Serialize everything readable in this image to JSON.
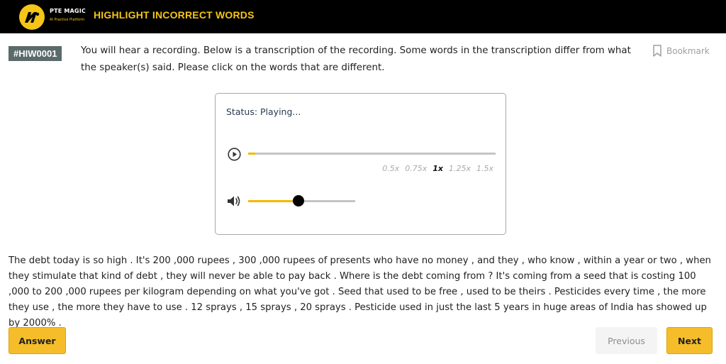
{
  "header": {
    "brand_name": "PTE MAGIC",
    "brand_tagline": "AI Practice Platform",
    "title": "HIGHLIGHT INCORRECT WORDS",
    "accent_color": "#f5c518"
  },
  "question": {
    "code": "#HIW0001",
    "instruction": "You will hear a recording. Below is a transcription of the recording. Some words in the transcription differ from what the speaker(s) said. Please click on the words that are different.",
    "bookmark_label": "Bookmark"
  },
  "player": {
    "status": "Status: Playing...",
    "play_icon": "play-circle-icon",
    "volume_icon": "volume-icon",
    "progress": 0.03,
    "volume": 0.47,
    "speeds": [
      "0.5x",
      "0.75x",
      "1x",
      "1.25x",
      "1.5x"
    ],
    "active_speed": "1x"
  },
  "transcript": "The debt today is so high . It's 200 ,000 rupees , 300 ,000 rupees of presents who have no money , and they , who know , within a year or two , when they stimulate that kind of debt , they will never be able to pay back . Where is the debt coming from ? It's coming from a seed that is costing 100 ,000 to 200 ,000 rupees per kilogram depending on what you've got . Seed that used to be free , used to be theirs . Pesticides every time , the more they use , the more they have to use . 12 sprays , 15 sprays , 20 sprays . Pesticide used in just the last 5 years in huge areas of India has showed up by 2000% .",
  "buttons": {
    "answer": "Answer",
    "previous": "Previous",
    "next": "Next"
  }
}
